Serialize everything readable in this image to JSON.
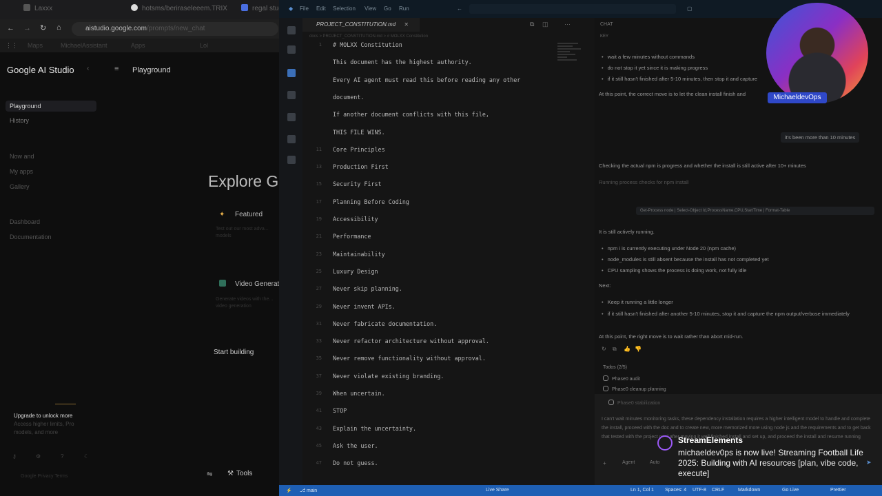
{
  "browser": {
    "tabs": [
      "Laxxx",
      "hotsms/beriraseleeem.TRIXX",
      "regal studia"
    ],
    "address": "aistudio.google.com",
    "address_rest": "/prompts/new_chat",
    "bookmarks": [
      "Maps",
      "MichaelAssistant",
      "Apps",
      "Lol"
    ]
  },
  "ai_studio": {
    "logo": "Google AI Studio",
    "breadcrumb": "Playground",
    "nav": [
      {
        "label": "Playground",
        "active": true
      },
      {
        "label": "History",
        "active": false
      },
      {
        "label": "Now and",
        "active": false
      },
      {
        "label": "My apps",
        "active": false
      },
      {
        "label": "Gallery",
        "active": false
      },
      {
        "label": "Dashboard",
        "active": false
      },
      {
        "label": "Documentation",
        "active": false
      }
    ],
    "explore_heading": "Explore Go",
    "featured_title": "Featured",
    "featured_desc": "Test out our most adva... models",
    "video_title": "Video Generat",
    "video_desc": "Generate videos with the... video generation",
    "start_building": "Start building",
    "upgrade_title": "Upgrade to unlock more",
    "upgrade_desc": "Access higher limits, Pro models, and more",
    "footer": "Google Privacy Terms",
    "tools_label": "Tools"
  },
  "vscode": {
    "menu": [
      "File",
      "Edit",
      "Selection",
      "View",
      "Go",
      "Run"
    ],
    "tab_label": "PROJECT_CONSTITUTION.md",
    "breadcrumb": "docs > PROJECT_CONSTITUTION.md > # MOLXX Constitution",
    "code_lines": [
      {
        "n": "1",
        "t": "# MOLXX Constitution"
      },
      {
        "n": "",
        "t": "This document has the highest authority."
      },
      {
        "n": "",
        "t": "Every AI agent must read this before reading any other"
      },
      {
        "n": "",
        "t": "document."
      },
      {
        "n": "",
        "t": "If another document conflicts with this file,"
      },
      {
        "n": "",
        "t": "THIS FILE WINS."
      },
      {
        "n": "11",
        "t": "Core Principles"
      },
      {
        "n": "13",
        "t": "Production First"
      },
      {
        "n": "15",
        "t": "Security First"
      },
      {
        "n": "17",
        "t": "Planning Before Coding"
      },
      {
        "n": "19",
        "t": "Accessibility"
      },
      {
        "n": "21",
        "t": "Performance"
      },
      {
        "n": "23",
        "t": "Maintainability"
      },
      {
        "n": "25",
        "t": "Luxury Design"
      },
      {
        "n": "27",
        "t": "Never skip planning."
      },
      {
        "n": "29",
        "t": "Never invent APIs."
      },
      {
        "n": "31",
        "t": "Never fabricate documentation."
      },
      {
        "n": "33",
        "t": "Never refactor architecture without approval."
      },
      {
        "n": "35",
        "t": "Never remove functionality without approval."
      },
      {
        "n": "37",
        "t": "Never violate existing branding."
      },
      {
        "n": "39",
        "t": "When uncertain."
      },
      {
        "n": "41",
        "t": "STOP"
      },
      {
        "n": "43",
        "t": "Explain the uncertainty."
      },
      {
        "n": "45",
        "t": "Ask the user."
      },
      {
        "n": "47",
        "t": "Do not guess."
      }
    ],
    "chat": {
      "header": "CHAT",
      "key": "KEY",
      "bullets_top": [
        "wait a few minutes without commands",
        "do not stop it yet since it is making progress",
        "if it still hasn't finished after 5-10 minutes, then stop it and capture"
      ],
      "para1": "At this point, the correct move is to let the clean install finish and",
      "user_bubble": "it's been more than 10 minutes",
      "para2": "Checking the actual npm is progress and whether the install is still active after 10+ minutes",
      "faint1": "Running process checks for npm install",
      "cmd_bubble": "Get-Process node | Select-Object Id,ProcessName,CPU,StartTime | Format-Table",
      "para3": "It is still actively running.",
      "bullets_mid": [
        "npm i is currently executing under Node 20 (npm cache)",
        "node_modules is still absent because the install has not completed yet",
        "CPU sampling shows the process is doing work, not fully idle"
      ],
      "next_label": "Next:",
      "bullets_next": [
        "Keep it running a little longer",
        "if it still hasn't finished after another 5-10 minutes, stop it and capture the npm output/verbose immediately"
      ],
      "para4": "At this point, the right move is to wait rather than abort mid-run.",
      "todos_label": "Todos (2/5)",
      "todos": [
        "Phase0 audit",
        "Phase0 cleanup planning",
        "Phase0 stabilization"
      ],
      "composer_text": "I can't wait minutes monitoring tasks, these dependency installation requires a higher intelligent model to handle and complete the install, proceed with the doc and to create new, more memorized more using node js and the requirements and to get back that tested with the project goal after moving it well finished install and set up, and proceed the install and resume running",
      "agent_label": "Agent",
      "model_label": "Auto"
    },
    "status_items": [
      "main",
      "Live Share",
      "Ln 1, Col 1",
      "Spaces: 4",
      "UTF-8",
      "CRLF",
      "Markdown",
      "Go Live",
      "Prettier"
    ]
  },
  "webcam_tag": "MichaeldevOps",
  "alert": {
    "title": "StreamElements",
    "message": "michaeldev0ps is now live! Streaming Football Life 2025: Building with AI resources [plan, vibe code, execute]"
  }
}
